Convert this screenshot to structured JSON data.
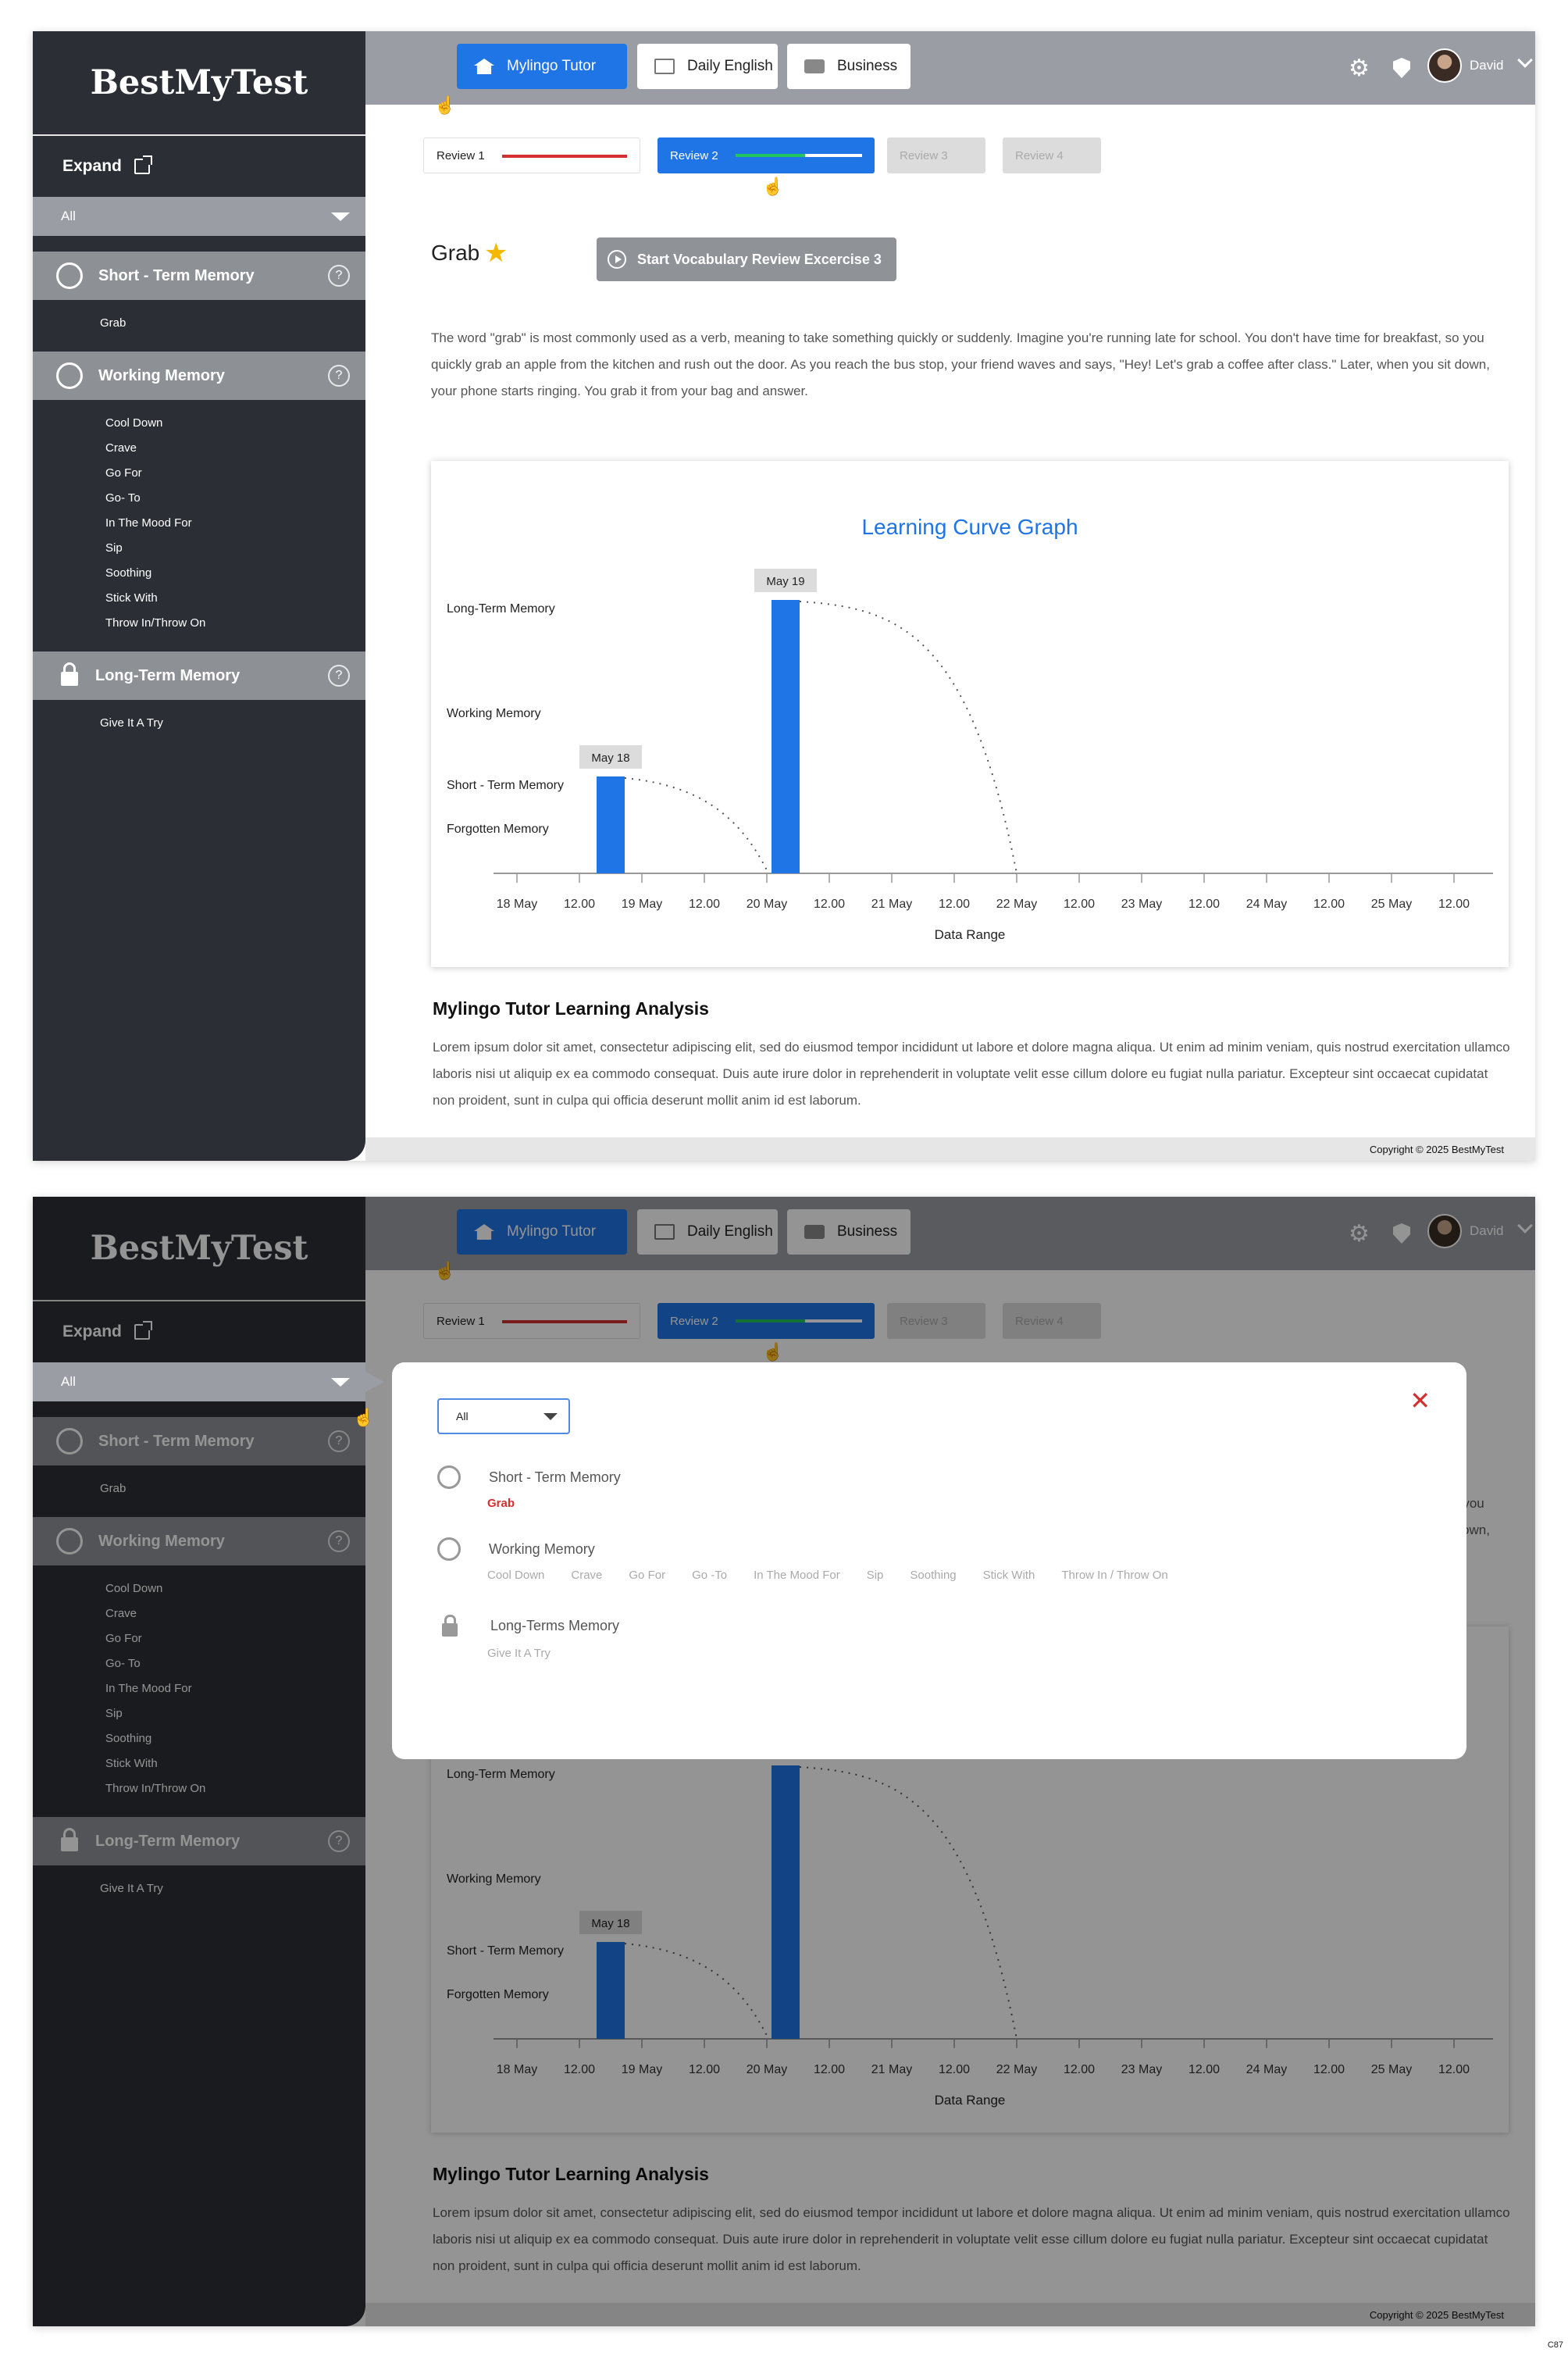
{
  "brand": "BestMyTest",
  "sidebar": {
    "expand_label": "Expand",
    "filter_value": "All",
    "categories": [
      {
        "name": "Short - Term Memory",
        "help": "?",
        "items": [
          "Grab"
        ]
      },
      {
        "name": "Working Memory",
        "help": "?",
        "items": [
          "Cool Down",
          "Crave",
          "Go For",
          "Go- To",
          "In The Mood For",
          "Sip",
          "Soothing",
          "Stick With",
          "Throw In/Throw On"
        ]
      },
      {
        "name": "Long-Term Memory",
        "help": "?",
        "items": [
          "Give It A Try"
        ]
      }
    ]
  },
  "topbar": {
    "tabs": [
      "Mylingo Tutor",
      "Daily English",
      "Business"
    ],
    "user_name": "David"
  },
  "reviews": [
    "Review 1",
    "Review 2",
    "Review 3",
    "Review 4"
  ],
  "review_progress": {
    "review1": 1.0,
    "review2": 0.55
  },
  "word": "Grab",
  "start_button": "Start Vocabulary Review Excercise 3",
  "description": "The word \"grab\" is most commonly used as a verb, meaning to take something quickly or suddenly. Imagine you're running late for school. You don't have time for breakfast, so you quickly grab an apple from the kitchen and rush out the door. As you reach the bus stop, your friend waves and says, \"Hey! Let's grab a coffee after class.\" Later, when you sit down, your phone starts ringing. You grab it from your bag and answer.",
  "chart_data": {
    "type": "bar",
    "title": "Learning Curve Graph",
    "xlabel": "Data Range",
    "x_ticks": [
      "18 May",
      "12.00",
      "19 May",
      "12.00",
      "20 May",
      "12.00",
      "21 May",
      "12.00",
      "22 May",
      "12.00",
      "23 May",
      "12.00",
      "24 May",
      "12.00",
      "25 May",
      "12.00"
    ],
    "y_levels": [
      "Forgotten Memory",
      "Short - Term  Memory",
      "Working Memory",
      "Long-Term Memory"
    ],
    "bars": [
      {
        "label": "May 18",
        "x": 1.4,
        "level": "Short - Term  Memory"
      },
      {
        "label": "May 19",
        "x": 4.2,
        "level": "Long-Term Memory"
      }
    ],
    "colors": {
      "bar": "#1f74e6",
      "title": "#1f74e6",
      "decay": "#555555"
    },
    "grid": false
  },
  "analysis": {
    "title": "Mylingo Tutor Learning Analysis",
    "text": "Lorem ipsum dolor sit amet, consectetur adipiscing elit, sed do eiusmod tempor incididunt ut labore et dolore magna aliqua. Ut enim ad minim veniam, quis nostrud exercitation ullamco laboris nisi ut aliquip ex ea commodo consequat. Duis aute irure dolor in reprehenderit in voluptate velit esse cillum dolore eu fugiat nulla pariatur. Excepteur sint occaecat cupidatat non proident, sunt in culpa qui officia deserunt mollit anim id est laborum."
  },
  "footer": "Copyright © 2025  BestMyTest",
  "modal": {
    "select_value": "All",
    "categories": [
      {
        "name": "Short - Term Memory",
        "items": [
          "Grab"
        ]
      },
      {
        "name": "Working Memory",
        "items": [
          "Cool Down",
          "Crave",
          "Go For",
          "Go -To",
          "In The Mood For",
          "Sip",
          "Soothing",
          "Stick With",
          "Throw In / Throw On"
        ]
      },
      {
        "name": "Long-Terms Memory",
        "items": [
          "Give It A Try"
        ]
      }
    ]
  },
  "page_id": "C87"
}
